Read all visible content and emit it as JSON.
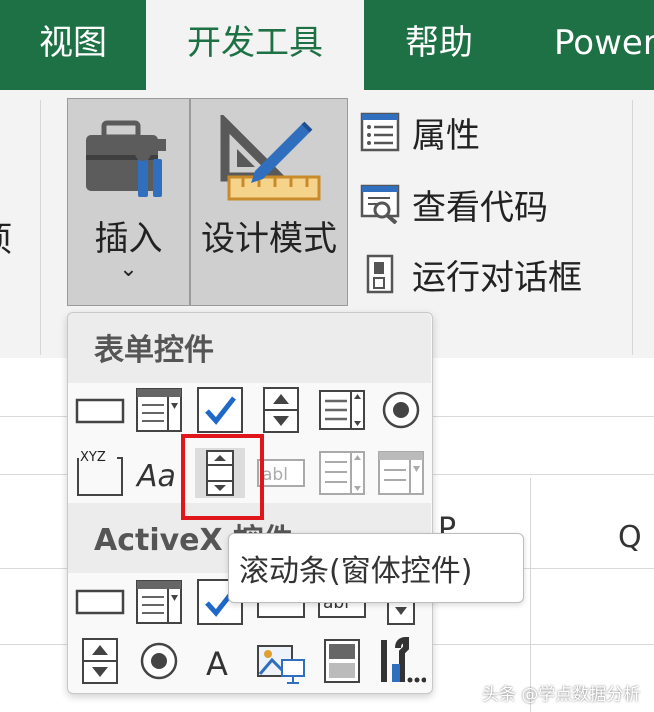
{
  "colors": {
    "accent": "#1e7145",
    "highlight": "#e0161b",
    "check": "#1e68c8"
  },
  "tabs": [
    {
      "label": "视图",
      "active": false
    },
    {
      "label": "开发工具",
      "active": true
    },
    {
      "label": "帮助",
      "active": false
    },
    {
      "label": "Power",
      "active": false
    }
  ],
  "ribbon": {
    "partial_left_label": "项",
    "insert": {
      "label": "插入",
      "icon": "toolbox-icon",
      "chevron": "⌄"
    },
    "design_mode": {
      "label": "设计模式",
      "icon": "triangle-ruler-pencil-icon"
    },
    "side": [
      {
        "label": "属性",
        "icon": "properties-icon"
      },
      {
        "label": "查看代码",
        "icon": "view-code-icon"
      },
      {
        "label": "运行对话框",
        "icon": "run-dialog-icon"
      }
    ]
  },
  "sheet": {
    "col_p": "P",
    "col_q": "Q"
  },
  "dropdown": {
    "form_controls_title": "表单控件",
    "form_controls": [
      [
        "button",
        "combo-box",
        "checkbox",
        "spin-button",
        "list-box",
        "option-button"
      ],
      [
        "group-box",
        "label",
        "scroll-bar",
        "text-field",
        "combo-list-edit",
        "combo-dropdown-edit"
      ]
    ],
    "group_box_text": "XYZ",
    "label_text": "Aa",
    "text_field_text": "abl",
    "activex_title": "ActiveX 控件",
    "activex_controls": [
      [
        "command-button",
        "combo-box",
        "checkbox",
        "text-box",
        "text-box-abl",
        "scroll-bar"
      ],
      [
        "spin-button",
        "option-button",
        "label",
        "image",
        "toggle-button",
        "more-controls"
      ]
    ],
    "activex_label_text": "A",
    "activex_textbox_text": "abl"
  },
  "tooltip": {
    "text": "滚动条(窗体控件)"
  },
  "watermark": "头条 @学点数据分析"
}
